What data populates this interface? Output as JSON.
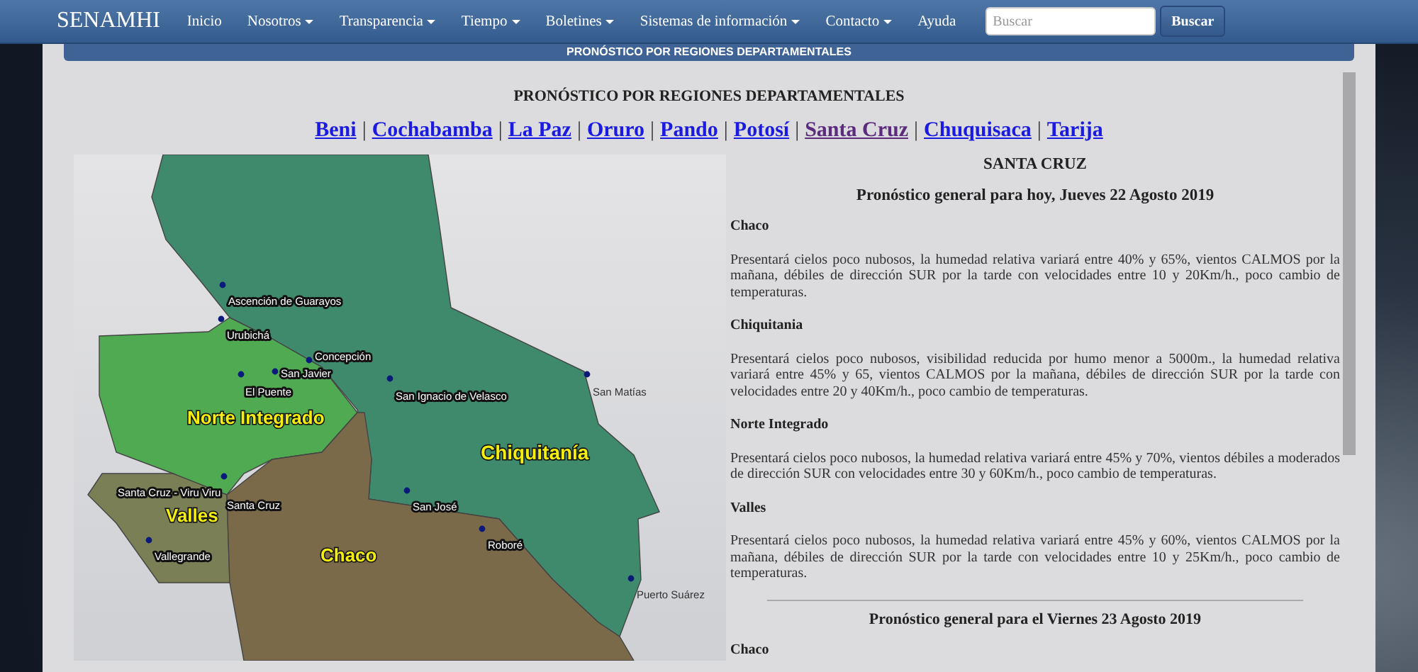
{
  "navbar": {
    "brand": "SENAMHI",
    "items": [
      {
        "label": "Inicio",
        "dropdown": false
      },
      {
        "label": "Nosotros",
        "dropdown": true
      },
      {
        "label": "Transparencia",
        "dropdown": true
      },
      {
        "label": "Tiempo",
        "dropdown": true
      },
      {
        "label": "Boletines",
        "dropdown": true
      },
      {
        "label": "Sistemas de información",
        "dropdown": true
      },
      {
        "label": "Contacto",
        "dropdown": true
      },
      {
        "label": "Ayuda",
        "dropdown": false
      }
    ],
    "search": {
      "placeholder": "Buscar",
      "button": "Buscar"
    }
  },
  "banner": "PRONÓSTICO POR REGIONES DEPARTAMENTALES",
  "page_title": "PRONÓSTICO POR REGIONES DEPARTAMENTALES",
  "link_separator": "|",
  "department_links": [
    {
      "label": "Beni",
      "visited": false
    },
    {
      "label": "Cochabamba",
      "visited": false
    },
    {
      "label": "La Paz",
      "visited": false
    },
    {
      "label": "Oruro",
      "visited": false
    },
    {
      "label": "Pando",
      "visited": false
    },
    {
      "label": "Potosí",
      "visited": false
    },
    {
      "label": "Santa Cruz",
      "visited": true
    },
    {
      "label": "Chuquisaca",
      "visited": false
    },
    {
      "label": "Tarija",
      "visited": false
    }
  ],
  "map": {
    "regions": [
      "Chiquitanía",
      "Norte Integrado",
      "Valles",
      "Chaco"
    ],
    "cities": [
      "Ascención de Guarayos",
      "Urubichá",
      "Concepción",
      "San Javier",
      "El Puente",
      "San Ignacio de Velasco",
      "San Matías",
      "Santa Cruz - Viru Viru",
      "Santa Cruz",
      "San José",
      "Roboré",
      "Vallegrande",
      "Puerto Suárez"
    ]
  },
  "forecast": {
    "department": "SANTA CRUZ",
    "days": [
      {
        "heading": "Pronóstico general para hoy, Jueves 22 Agosto 2019",
        "regions": [
          {
            "name": "Chaco",
            "text": "Presentará cielos poco nubosos, la humedad relativa variará entre 40% y 65%, vientos CALMOS por la mañana, débiles de dirección SUR por la tarde con velocidades entre 10 y 20Km/h., poco cambio de temperaturas."
          },
          {
            "name": "Chiquitania",
            "text": "Presentará cielos poco nubosos, visibilidad reducida por humo menor a 5000m., la humedad relativa variará entre 45% y 65, vientos CALMOS por la mañana, débiles de dirección SUR por la tarde con velocidades entre 20 y 40Km/h., poco cambio de temperaturas."
          },
          {
            "name": "Norte Integrado",
            "text": "Presentará cielos poco nubosos, la humedad relativa variará entre 45% y 70%, vientos débiles a moderados de dirección SUR con velocidades entre 30 y 60Km/h., poco cambio de temperaturas."
          },
          {
            "name": "Valles",
            "text": "Presentará cielos poco nubosos, la humedad relativa variará entre 45% y 60%, vientos CALMOS por la mañana, débiles de dirección SUR por la tarde con velocidades entre 10 y 25Km/h., poco cambio de temperaturas."
          }
        ]
      },
      {
        "heading": "Pronóstico general para el Viernes 23 Agosto 2019",
        "regions": [
          {
            "name": "Chaco"
          }
        ]
      }
    ]
  }
}
